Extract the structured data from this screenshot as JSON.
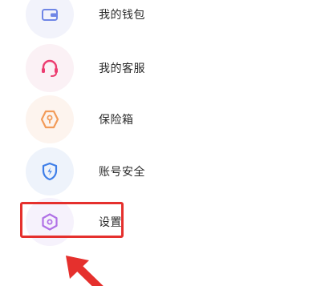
{
  "menu": {
    "items": [
      {
        "label": "我的钱包",
        "icon": "wallet-icon"
      },
      {
        "label": "我的客服",
        "icon": "headset-icon"
      },
      {
        "label": "保险箱",
        "icon": "safe-box-icon"
      },
      {
        "label": "账号安全",
        "icon": "shield-icon"
      },
      {
        "label": "设置",
        "icon": "settings-hexagon-icon"
      }
    ]
  },
  "colors": {
    "wallet_icon": "#6f86e6",
    "service_icon": "#ec3d70",
    "safe_icon": "#f29b59",
    "security_icon": "#3e7ee8",
    "settings_icon": "#b071e6",
    "highlight": "#e5302d",
    "label_text": "#2b2b2b"
  }
}
